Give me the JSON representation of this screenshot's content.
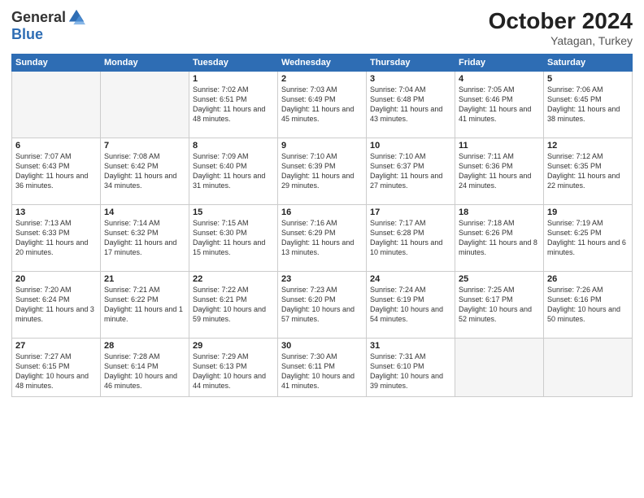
{
  "logo": {
    "general": "General",
    "blue": "Blue"
  },
  "title": "October 2024",
  "location": "Yatagan, Turkey",
  "days_header": [
    "Sunday",
    "Monday",
    "Tuesday",
    "Wednesday",
    "Thursday",
    "Friday",
    "Saturday"
  ],
  "weeks": [
    [
      {
        "day": "",
        "info": ""
      },
      {
        "day": "",
        "info": ""
      },
      {
        "day": "1",
        "info": "Sunrise: 7:02 AM\nSunset: 6:51 PM\nDaylight: 11 hours and 48 minutes."
      },
      {
        "day": "2",
        "info": "Sunrise: 7:03 AM\nSunset: 6:49 PM\nDaylight: 11 hours and 45 minutes."
      },
      {
        "day": "3",
        "info": "Sunrise: 7:04 AM\nSunset: 6:48 PM\nDaylight: 11 hours and 43 minutes."
      },
      {
        "day": "4",
        "info": "Sunrise: 7:05 AM\nSunset: 6:46 PM\nDaylight: 11 hours and 41 minutes."
      },
      {
        "day": "5",
        "info": "Sunrise: 7:06 AM\nSunset: 6:45 PM\nDaylight: 11 hours and 38 minutes."
      }
    ],
    [
      {
        "day": "6",
        "info": "Sunrise: 7:07 AM\nSunset: 6:43 PM\nDaylight: 11 hours and 36 minutes."
      },
      {
        "day": "7",
        "info": "Sunrise: 7:08 AM\nSunset: 6:42 PM\nDaylight: 11 hours and 34 minutes."
      },
      {
        "day": "8",
        "info": "Sunrise: 7:09 AM\nSunset: 6:40 PM\nDaylight: 11 hours and 31 minutes."
      },
      {
        "day": "9",
        "info": "Sunrise: 7:10 AM\nSunset: 6:39 PM\nDaylight: 11 hours and 29 minutes."
      },
      {
        "day": "10",
        "info": "Sunrise: 7:10 AM\nSunset: 6:37 PM\nDaylight: 11 hours and 27 minutes."
      },
      {
        "day": "11",
        "info": "Sunrise: 7:11 AM\nSunset: 6:36 PM\nDaylight: 11 hours and 24 minutes."
      },
      {
        "day": "12",
        "info": "Sunrise: 7:12 AM\nSunset: 6:35 PM\nDaylight: 11 hours and 22 minutes."
      }
    ],
    [
      {
        "day": "13",
        "info": "Sunrise: 7:13 AM\nSunset: 6:33 PM\nDaylight: 11 hours and 20 minutes."
      },
      {
        "day": "14",
        "info": "Sunrise: 7:14 AM\nSunset: 6:32 PM\nDaylight: 11 hours and 17 minutes."
      },
      {
        "day": "15",
        "info": "Sunrise: 7:15 AM\nSunset: 6:30 PM\nDaylight: 11 hours and 15 minutes."
      },
      {
        "day": "16",
        "info": "Sunrise: 7:16 AM\nSunset: 6:29 PM\nDaylight: 11 hours and 13 minutes."
      },
      {
        "day": "17",
        "info": "Sunrise: 7:17 AM\nSunset: 6:28 PM\nDaylight: 11 hours and 10 minutes."
      },
      {
        "day": "18",
        "info": "Sunrise: 7:18 AM\nSunset: 6:26 PM\nDaylight: 11 hours and 8 minutes."
      },
      {
        "day": "19",
        "info": "Sunrise: 7:19 AM\nSunset: 6:25 PM\nDaylight: 11 hours and 6 minutes."
      }
    ],
    [
      {
        "day": "20",
        "info": "Sunrise: 7:20 AM\nSunset: 6:24 PM\nDaylight: 11 hours and 3 minutes."
      },
      {
        "day": "21",
        "info": "Sunrise: 7:21 AM\nSunset: 6:22 PM\nDaylight: 11 hours and 1 minute."
      },
      {
        "day": "22",
        "info": "Sunrise: 7:22 AM\nSunset: 6:21 PM\nDaylight: 10 hours and 59 minutes."
      },
      {
        "day": "23",
        "info": "Sunrise: 7:23 AM\nSunset: 6:20 PM\nDaylight: 10 hours and 57 minutes."
      },
      {
        "day": "24",
        "info": "Sunrise: 7:24 AM\nSunset: 6:19 PM\nDaylight: 10 hours and 54 minutes."
      },
      {
        "day": "25",
        "info": "Sunrise: 7:25 AM\nSunset: 6:17 PM\nDaylight: 10 hours and 52 minutes."
      },
      {
        "day": "26",
        "info": "Sunrise: 7:26 AM\nSunset: 6:16 PM\nDaylight: 10 hours and 50 minutes."
      }
    ],
    [
      {
        "day": "27",
        "info": "Sunrise: 7:27 AM\nSunset: 6:15 PM\nDaylight: 10 hours and 48 minutes."
      },
      {
        "day": "28",
        "info": "Sunrise: 7:28 AM\nSunset: 6:14 PM\nDaylight: 10 hours and 46 minutes."
      },
      {
        "day": "29",
        "info": "Sunrise: 7:29 AM\nSunset: 6:13 PM\nDaylight: 10 hours and 44 minutes."
      },
      {
        "day": "30",
        "info": "Sunrise: 7:30 AM\nSunset: 6:11 PM\nDaylight: 10 hours and 41 minutes."
      },
      {
        "day": "31",
        "info": "Sunrise: 7:31 AM\nSunset: 6:10 PM\nDaylight: 10 hours and 39 minutes."
      },
      {
        "day": "",
        "info": ""
      },
      {
        "day": "",
        "info": ""
      }
    ]
  ]
}
